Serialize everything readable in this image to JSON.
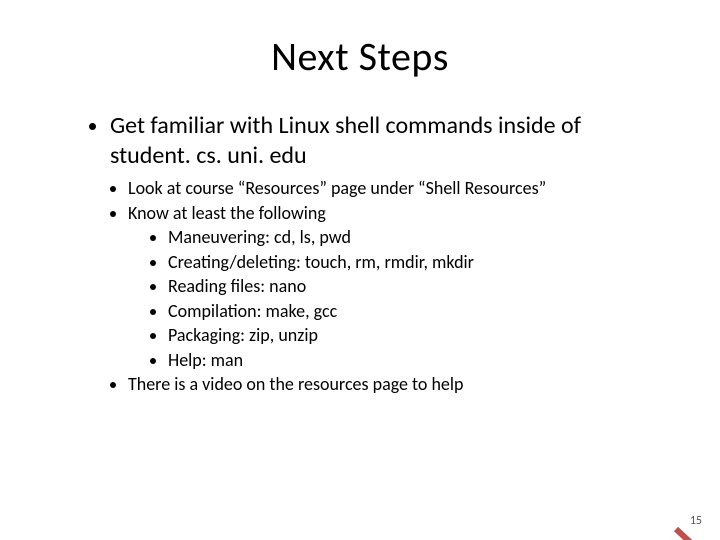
{
  "title": "Next Steps",
  "main_bullet": "Get familiar with Linux shell commands inside of student. cs. uni. edu",
  "sub1": "Look at course “Resources” page under “Shell Resources”",
  "sub2": "Know at least the following",
  "sub2_items": [
    "Maneuvering: cd, ls, pwd",
    "Creating/deleting: touch, rm, rmdir, mkdir",
    "Reading files: nano",
    "Compilation: make, gcc",
    "Packaging: zip, unzip",
    "Help: man"
  ],
  "sub3": "There is a video on the resources page to help",
  "page_number": "15"
}
